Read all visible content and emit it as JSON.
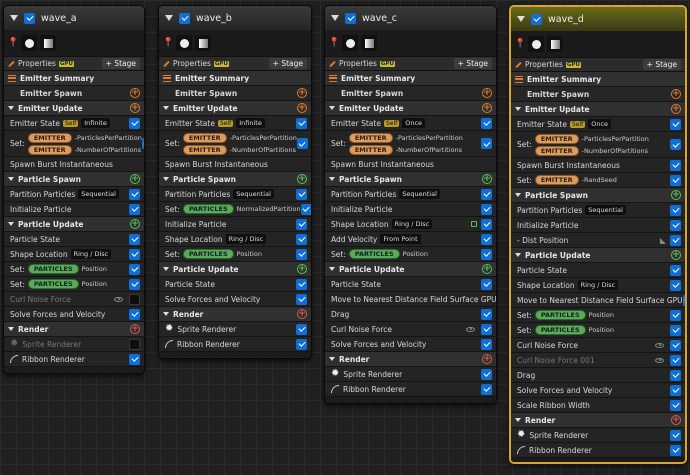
{
  "colors": {
    "accent": "#0f6fd6",
    "selected_border": "#d9a52e",
    "emitter_pill": "#e09a5a",
    "particles_pill": "#5aaa5a",
    "gpu_badge": "#c9b92e"
  },
  "common": {
    "properties": "Properties",
    "gpu": "GPU",
    "stage": "+ Stage",
    "emitter_summary": "Emitter Summary",
    "emitter_spawn": "Emitter Spawn",
    "emitter_update": "Emitter Update",
    "emitter_state": "Emitter State",
    "self": "Self",
    "set": "Set:",
    "emitter": "EMITTER",
    "particles": "PARTICLES",
    "particles_per_partition": "-ParticlesPerPartition",
    "number_of_partitions": "-NumberOfPartitions",
    "spawn_burst": "Spawn Burst Instantaneous",
    "particle_spawn": "Particle Spawn",
    "partition_particles": "Partition Particles",
    "sequential": "Sequential",
    "initialize_particle": "Initialize Particle",
    "particle_update": "Particle Update",
    "particle_state": "Particle State",
    "shape_location": "Shape Location",
    "ring_disc": "Ring / Disc",
    "position": "Position",
    "curl_noise": "Curl Noise Force",
    "solve_forces": "Solve Forces and Velocity",
    "render": "Render",
    "sprite_renderer": "Sprite Renderer",
    "ribbon_renderer": "Ribbon Renderer"
  },
  "a": {
    "title": "wave_a",
    "state": "Infinite"
  },
  "b": {
    "title": "wave_b",
    "state": "Infinite",
    "normalized": "NormalizedPartition"
  },
  "c": {
    "title": "wave_c",
    "state": "Once",
    "add_velocity": "Add Velocity",
    "from_point": "From Point",
    "move_nearest": "Move to Nearest Distance Field Surface GPU",
    "drag": "Drag"
  },
  "d": {
    "title": "wave_d",
    "state": "Once",
    "rand_seed": "-RandSeed",
    "dist_position": "- Dist Position",
    "curl_noise_001": "Curl Noise Force 001",
    "scale_ribbon": "Scale Ribbon Width"
  }
}
